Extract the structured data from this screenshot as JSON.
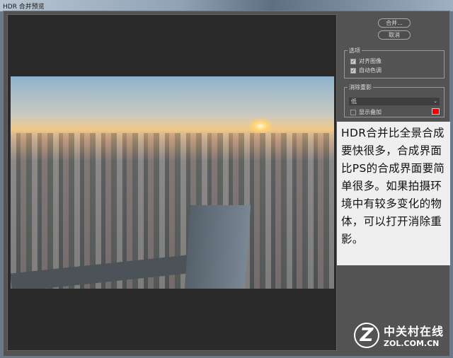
{
  "window": {
    "title": "HDR 合并预览"
  },
  "buttons": {
    "merge": "合并...",
    "cancel": "取消"
  },
  "options": {
    "label": "选项",
    "align_images": {
      "label": "对齐图像",
      "checked": true
    },
    "auto_tone": {
      "label": "自动色调",
      "checked": true
    }
  },
  "deghost": {
    "label": "消除重影",
    "level": "低",
    "show_overlay": {
      "label": "显示叠加",
      "checked": false
    },
    "overlay_color": "#e00000"
  },
  "caption": "HDR合并比全景合成要快很多，合成界面比PS的合成界面要简单很多。如果拍摄环境中有较多变化的物体，可以打开消除重影。",
  "watermark": {
    "brand": "中关村在线",
    "domain": "ZOL.COM.CN",
    "mark": "Z"
  }
}
